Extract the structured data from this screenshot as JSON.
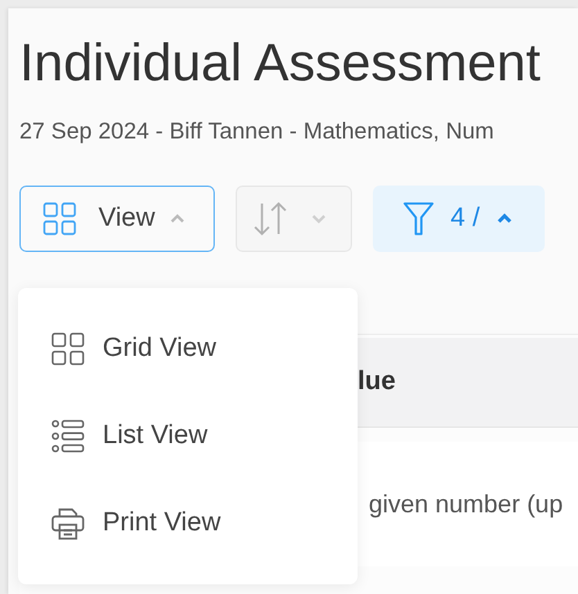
{
  "title": "Individual Assessment",
  "subtitle": "27 Sep 2024 - Biff Tannen - Mathematics, Num",
  "toolbar": {
    "view_button": {
      "label": "View",
      "expanded": true
    },
    "sort_button": {
      "disabled": true
    },
    "filter_button": {
      "label": "4 /",
      "expanded": true
    }
  },
  "view_menu": [
    {
      "kind": "grid",
      "label": "Grid View"
    },
    {
      "kind": "list",
      "label": "List View"
    },
    {
      "kind": "print",
      "label": "Print View"
    }
  ],
  "table": {
    "header": "lue",
    "rows": [
      "given number (up"
    ]
  }
}
